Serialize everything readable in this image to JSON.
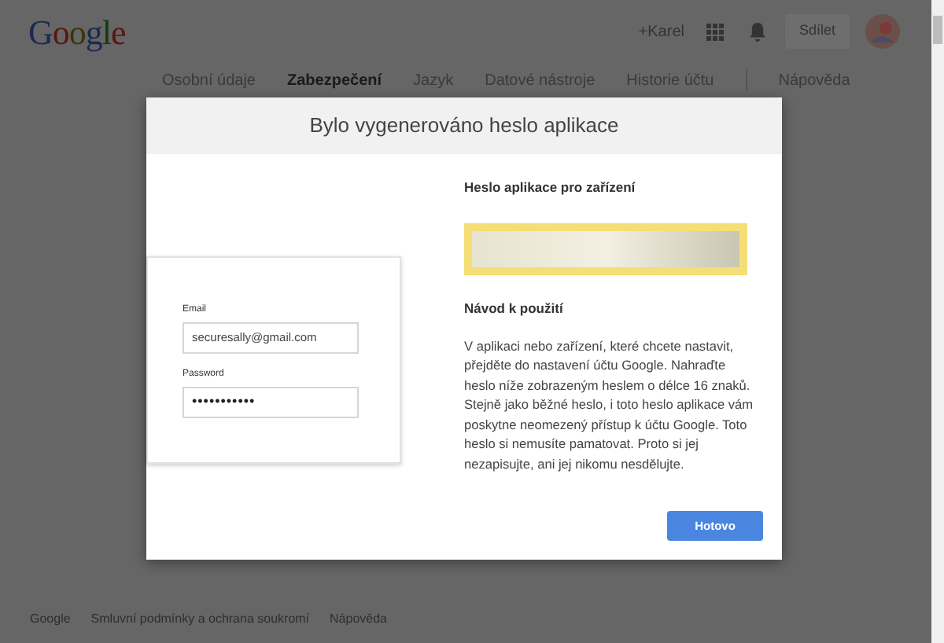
{
  "header": {
    "logo": "Google",
    "user_link": "+Karel",
    "share_button": "Sdílet"
  },
  "tabs": [
    {
      "label": "Osobní údaje",
      "selected": false
    },
    {
      "label": "Zabezpečení",
      "selected": true
    },
    {
      "label": "Jazyk",
      "selected": false
    },
    {
      "label": "Datové nástroje",
      "selected": false
    },
    {
      "label": "Historie účtu",
      "selected": false
    },
    {
      "label": "Nápověda",
      "selected": false
    }
  ],
  "dialog": {
    "title": "Bylo vygenerováno heslo aplikace",
    "illustration": {
      "email_label": "Email",
      "email_value": "securesally@gmail.com",
      "password_label": "Password",
      "password_value": "•••••••••••"
    },
    "password_heading": "Heslo aplikace pro zařízení",
    "instructions_heading": "Návod k použití",
    "instructions": [
      "V aplikaci nebo zařízení, které chcete nastavit, přejděte do nastavení účtu Google. Nahraďte heslo níže zobrazeným heslem o délce 16 znaků.",
      "Stejně jako běžné heslo, i toto heslo aplikace vám poskytne neomezený přístup k účtu Google. Toto heslo si nemusíte pamatovat. Proto si jej nezapisujte, ani jej nikomu nesdělujte."
    ],
    "done_button": "Hotovo"
  },
  "footer": [
    "Google",
    "Smluvní podmínky a ochrana soukromí",
    "Nápověda"
  ]
}
